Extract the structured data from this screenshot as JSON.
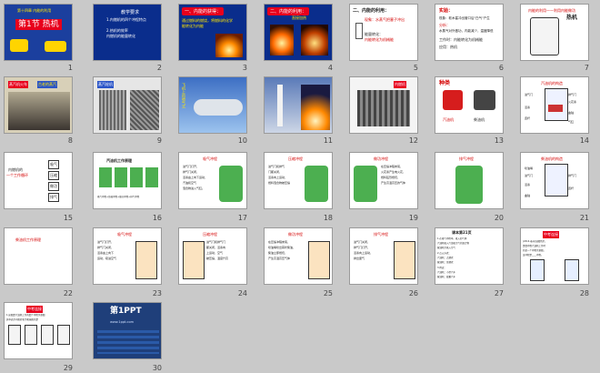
{
  "slides": [
    {
      "num": "1",
      "lines": [
        "第十四章 内能的利用",
        "第1节  热机"
      ]
    },
    {
      "num": "2",
      "lines": [
        "教学要求",
        "1.内燃机的四个冲程特点",
        "2.热机的效率",
        "内燃机的能量转化"
      ]
    },
    {
      "num": "3",
      "lines": [
        "一、内能的获得：",
        "通过燃料的燃烧，将燃料的化学",
        "能转化为内能"
      ]
    },
    {
      "num": "4",
      "lines": [
        "二、内能的利用：",
        "直接加热"
      ]
    },
    {
      "num": "5",
      "lines": [
        "二、内能的利用：",
        "现象：水蒸气把塞子冲出",
        "能量转化：",
        "内能转化为机械能"
      ]
    },
    {
      "num": "6",
      "lines": [
        "实验：",
        "现象：软木塞冲出管口后\"白气\"产生",
        "分析：",
        "水蒸气对外做功，内能减少，温度降低",
        "工作时：内能转化为机械能",
        "应用：热机"
      ]
    },
    {
      "num": "7",
      "lines": [
        "内能的利用——利用内能做功",
        "热机"
      ]
    },
    {
      "num": "8",
      "lines": [
        "蒸汽机火车",
        "古老的蒸汽"
      ]
    },
    {
      "num": "9",
      "lines": [
        "蒸汽轮机"
      ]
    },
    {
      "num": "10",
      "lines": [
        "飞机上的喷气式"
      ]
    },
    {
      "num": "11",
      "lines": []
    },
    {
      "num": "12",
      "lines": [
        "火箭上的喷气发动机",
        "内燃机"
      ]
    },
    {
      "num": "13",
      "lines": [
        "种类",
        "汽油机",
        "柴油机"
      ]
    },
    {
      "num": "14",
      "lines": [
        "汽油机的构造",
        "进气门",
        "排气门",
        "火花塞",
        "活塞",
        "曲轴",
        "连杆",
        "气缸"
      ]
    },
    {
      "num": "15",
      "lines": [
        "内燃机的",
        "一个工作循环",
        "吸气",
        "压缩",
        "做功",
        "排气"
      ]
    },
    {
      "num": "16",
      "lines": [
        "汽油机工作原理",
        "吸气冲程→压缩冲程→做功冲程→排气冲程"
      ]
    },
    {
      "num": "17",
      "lines": [
        "吸气冲程",
        "进气门打开，",
        "排气门关闭，",
        "活塞由上向下运动，",
        "汽油和空气",
        "混合物进入气缸。"
      ]
    },
    {
      "num": "18",
      "lines": [
        "压缩冲程",
        "进气门和排气",
        "门都关闭，",
        "活塞向上运动，",
        "燃料混合物被压缩"
      ]
    },
    {
      "num": "19",
      "lines": [
        "做功冲程",
        "在压缩冲程末尾，",
        "火花塞产生电火花，",
        "燃料猛烈燃烧，",
        "产生高温高压的气体"
      ]
    },
    {
      "num": "20",
      "lines": [
        "排气冲程"
      ]
    },
    {
      "num": "21",
      "lines": [
        "柴油机的构造",
        "喷油嘴",
        "进气门",
        "排气门",
        "活塞",
        "连杆",
        "曲轴"
      ]
    },
    {
      "num": "22",
      "lines": [
        "柴油机工作原理"
      ]
    },
    {
      "num": "23",
      "lines": [
        "吸气冲程",
        "进气门打开，",
        "排气门关闭，",
        "活塞由上向下",
        "运动，吸进空气"
      ]
    },
    {
      "num": "24",
      "lines": [
        "压缩冲程",
        "进气门和排气门",
        "都关闭，活塞向",
        "上运动，空气",
        "被压缩，温度升高"
      ]
    },
    {
      "num": "25",
      "lines": [
        "做功冲程",
        "在压缩冲程末尾，",
        "喷油嘴喷出雾状柴油，",
        "柴油立即燃烧，",
        "产生高温高压气体"
      ]
    },
    {
      "num": "26",
      "lines": [
        "排气冲程",
        "进气门关闭，",
        "排气门打开，",
        "活塞向上运动，",
        "排出废气"
      ]
    },
    {
      "num": "27",
      "lines": [
        "课本第21页",
        "1.在吸气冲程中，吸入的气体",
        "汽油机吸入汽油和空气的混合物",
        "柴油机只吸入空气",
        "2.点火方式：",
        "汽油机：点燃式",
        "柴油机：压燃式",
        "3.用途：",
        "汽油机：小型汽车",
        "柴油机：载重汽车"
      ]
    },
    {
      "num": "28",
      "lines": [
        "中考连接",
        "(2014·泰州)如图所示，",
        "是四冲程汽油机工作时",
        "的某一个冲程示意图，",
        "该冲程是____冲程。"
      ]
    },
    {
      "num": "29",
      "lines": [
        "中考连接",
        "1.如图是汽油机工作的四个冲程示意图",
        "其中表示内能转化为机械能的是"
      ]
    },
    {
      "num": "30",
      "lines": [
        "第1PPT",
        "www.1ppt.com"
      ]
    }
  ]
}
